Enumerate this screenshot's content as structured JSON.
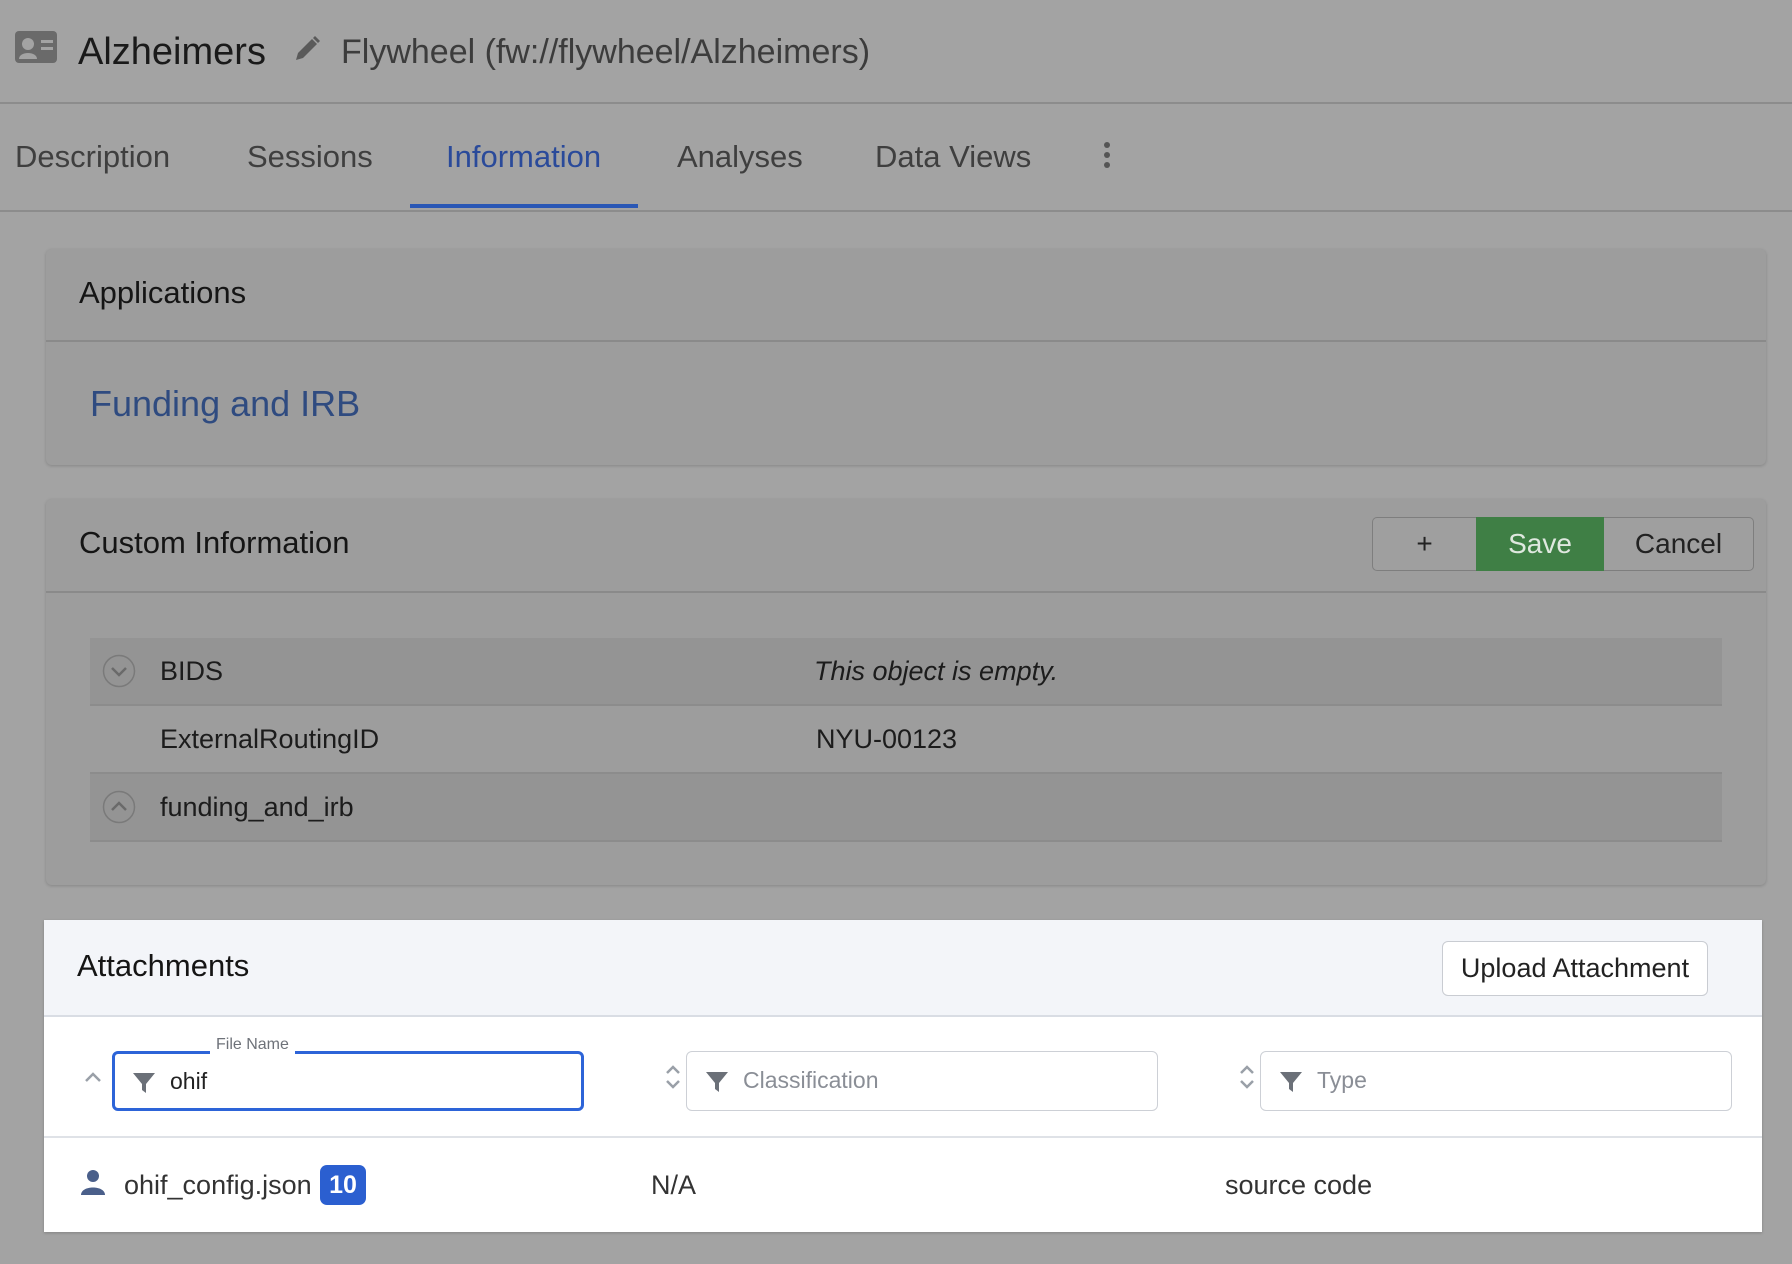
{
  "header": {
    "title": "Alzheimers",
    "path": "Flywheel (fw://flywheel/Alzheimers)",
    "icons": {
      "project": "id-card-icon",
      "edit": "pencil-icon"
    }
  },
  "tabs": [
    {
      "label": "Description",
      "active": false
    },
    {
      "label": "Sessions",
      "active": false
    },
    {
      "label": "Information",
      "active": true
    },
    {
      "label": "Analyses",
      "active": false
    },
    {
      "label": "Data Views",
      "active": false
    }
  ],
  "applications": {
    "title": "Applications",
    "link": "Funding and IRB"
  },
  "custom_info": {
    "title": "Custom Information",
    "add_label": "+",
    "save_label": "Save",
    "cancel_label": "Cancel",
    "rows": [
      {
        "key": "BIDS",
        "value": "This object is empty.",
        "state": "collapsed"
      },
      {
        "key": "ExternalRoutingID",
        "value": "NYU-00123"
      },
      {
        "key": "funding_and_irb",
        "value": "",
        "state": "expanded"
      }
    ]
  },
  "attachments": {
    "title": "Attachments",
    "upload_label": "Upload Attachment",
    "filters": {
      "file_name_label": "File Name",
      "file_name_value": "ohif",
      "classification_placeholder": "Classification",
      "type_placeholder": "Type"
    },
    "files": [
      {
        "name": "ohif_config.json",
        "badge": "10",
        "classification": "N/A",
        "type": "source code"
      }
    ]
  },
  "colors": {
    "accent": "#2b5fd0",
    "save": "#3f7f45",
    "link": "#2f4b80",
    "overlay_bg": "#a3a3a3"
  }
}
